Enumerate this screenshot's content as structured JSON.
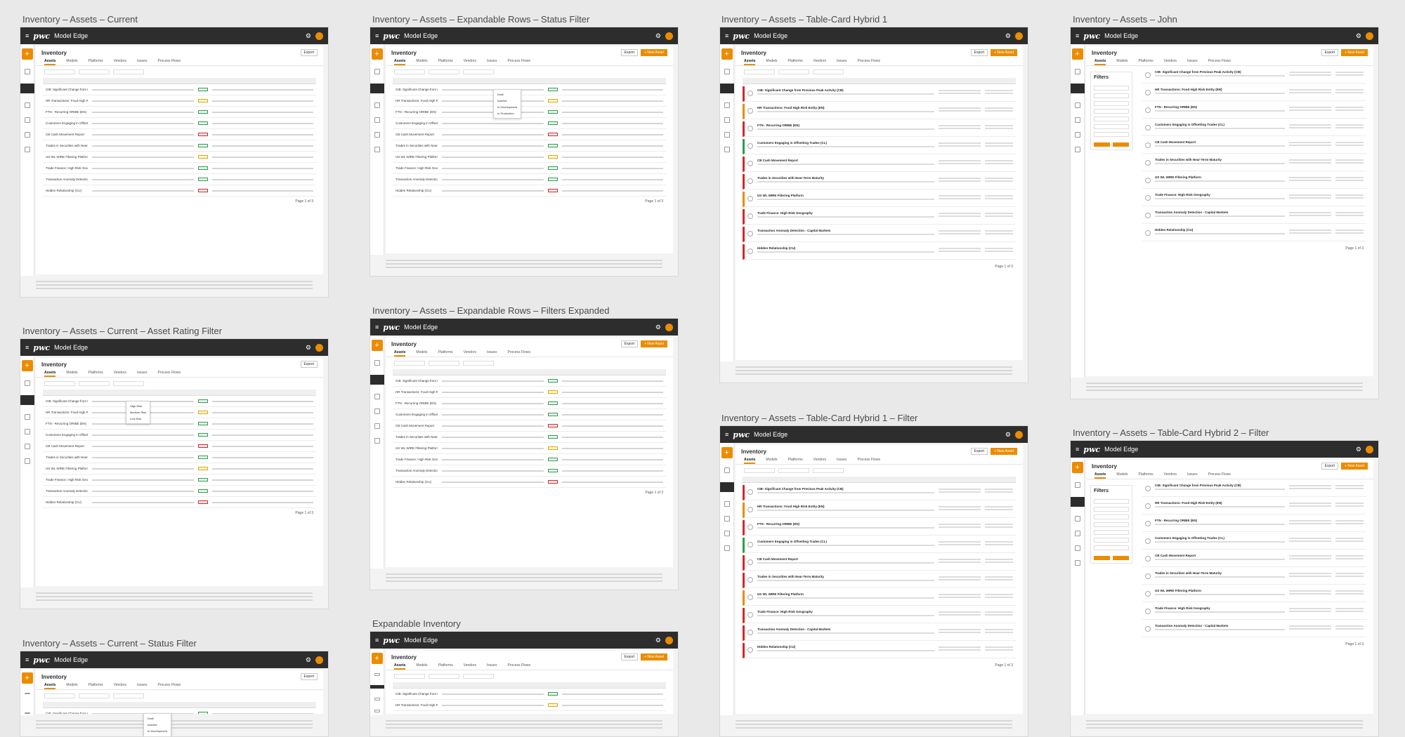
{
  "screens": {
    "s1": {
      "title": "Inventory – Assets – Current"
    },
    "s2": {
      "title": "Inventory – Assets – Expandable Rows – Status Filter"
    },
    "s3": {
      "title": "Inventory – Assets – Table-Card Hybrid 1"
    },
    "s4": {
      "title": "Inventory – Assets – John"
    },
    "s5": {
      "title": "Inventory – Assets – Current – Asset Rating Filter"
    },
    "s6": {
      "title": "Inventory – Assets – Expandable Rows – Filters Expanded"
    },
    "s7": {
      "title": "Inventory – Assets – Table-Card Hybrid 1 – Filter"
    },
    "s8": {
      "title": "Inventory – Assets – Table-Card Hybrid 2 – Filter"
    },
    "s9": {
      "title": "Inventory – Assets – Current – Status Filter"
    },
    "s10": {
      "title": "Expandable Inventory"
    }
  },
  "app": {
    "brand": "pwc",
    "product": "Model Edge",
    "page": "Inventory",
    "export": "Export",
    "new_asset": "+ New Asset",
    "filters": "Filters",
    "page_label": "Page 1 of 3"
  },
  "tabs": [
    "Assets",
    "Models",
    "Platforms",
    "Vendors",
    "Issues",
    "Process Flows"
  ],
  "rows": [
    "CIB: Significant Change from Previous Peak Activity (CB)",
    "HR Transactions: Food High Risk Entity (EN)",
    "FTN - Recurring ORIBE (EN)",
    "Customers Engaging in Offsetting Trades (CL)",
    "CB Cash Movement Report",
    "Trades in Securities with Near-Term Maturity",
    "US WL WIRE Filtering Platform",
    "Trade Finance: High Risk Geography",
    "Transaction Anomaly Detection - Capital Markets",
    "Hidden Relationship (CU)"
  ],
  "rating_options": [
    "High Risk",
    "Medium Risk",
    "Low Risk"
  ],
  "status_options": [
    "Draft",
    "Inactive",
    "In Development",
    "In Production"
  ],
  "colors": {
    "accent": "#eb8c00",
    "dark": "#2d2d2d",
    "red": "#d9262b",
    "green": "#2e9e4f"
  }
}
